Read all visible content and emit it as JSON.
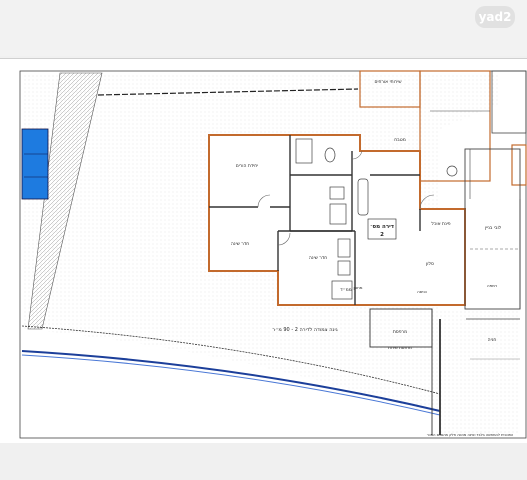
{
  "logo": {
    "text": "yad2"
  },
  "plan": {
    "apartment_title": "דירה מס׳",
    "apartment_number": "2",
    "rooms": {
      "master_bedroom": "יחידת הורים",
      "kitchen": "מטבח",
      "guest_bath": "שירותי אורחים",
      "dining": "פינת אוכל",
      "bedroom_1": "חדר שינה",
      "bedroom_2": "חדר שינה",
      "mamad": "ממ״ד",
      "living": "סלון",
      "entrance": "כניסה",
      "storage": "מחסן",
      "lobby": "לובי בניין"
    },
    "labels": {
      "garden": "גינה צמודה לדירה 2 - 90 מ״ר",
      "terrace": "מרפסת",
      "service": "מרפסת שירות",
      "parking": "חניה",
      "road": "רמפה"
    },
    "footer_note": "התוכנית להמחשה בלבד ואינה מהווה חלק מהסכם המכר"
  }
}
